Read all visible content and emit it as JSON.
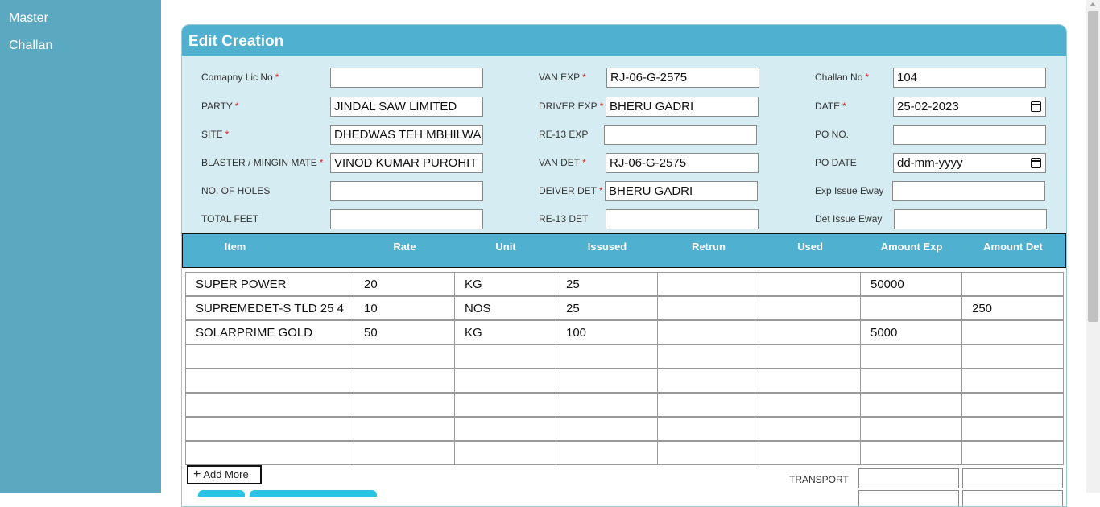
{
  "sidebar": {
    "items": [
      {
        "label": "Master"
      },
      {
        "label": "Challan"
      }
    ]
  },
  "card": {
    "title": "Edit Creation"
  },
  "form": {
    "col1": [
      {
        "label": "Comapny Lic No",
        "required": true,
        "value": ""
      },
      {
        "label": "PARTY",
        "required": true,
        "value": "JINDAL SAW LIMITED"
      },
      {
        "label": "SITE",
        "required": true,
        "value": "DHEDWAS TEH MBHILWA"
      },
      {
        "label": "BLASTER / MINGIN MATE",
        "required": true,
        "value": "VINOD KUMAR PUROHIT"
      },
      {
        "label": "NO. OF HOLES",
        "required": false,
        "value": ""
      },
      {
        "label": "TOTAL FEET",
        "required": false,
        "value": ""
      }
    ],
    "col2": [
      {
        "label": "VAN EXP",
        "required": true,
        "value": "RJ-06-G-2575"
      },
      {
        "label": "DRIVER EXP",
        "required": true,
        "value": "BHERU GADRI"
      },
      {
        "label": "RE-13 EXP",
        "required": false,
        "value": ""
      },
      {
        "label": "VAN DET",
        "required": true,
        "value": "RJ-06-G-2575"
      },
      {
        "label": "DEIVER DET",
        "required": true,
        "value": "BHERU GADRI"
      },
      {
        "label": "RE-13 DET",
        "required": false,
        "value": ""
      }
    ],
    "col3": [
      {
        "label": "Challan No",
        "required": true,
        "value": "104"
      },
      {
        "label": "DATE",
        "required": true,
        "value": "25-02-2023",
        "date": true
      },
      {
        "label": "PO NO.",
        "required": false,
        "value": ""
      },
      {
        "label": "PO DATE",
        "required": false,
        "value": "dd-mm-yyyy",
        "date": true
      },
      {
        "label": "Exp Issue Eway",
        "required": false,
        "value": ""
      },
      {
        "label": "Det Issue Eway",
        "required": false,
        "value": ""
      }
    ],
    "required_mark": "*"
  },
  "table": {
    "headers": [
      "Item",
      "Rate",
      "Unit",
      "Issused",
      "Retrun",
      "Used",
      "Amount Exp",
      "Amount Det"
    ],
    "rows": [
      [
        "SUPER POWER",
        "20",
        "KG",
        "25",
        "",
        "",
        "50000",
        ""
      ],
      [
        "SUPREMEDET-S TLD  25  4",
        "10",
        "NOS",
        "25",
        "",
        "",
        "",
        "250"
      ],
      [
        "SOLARPRIME GOLD",
        "50",
        "KG",
        "100",
        "",
        "",
        "5000",
        ""
      ],
      [
        "",
        "",
        "",
        "",
        "",
        "",
        "",
        ""
      ],
      [
        "",
        "",
        "",
        "",
        "",
        "",
        "",
        ""
      ],
      [
        "",
        "",
        "",
        "",
        "",
        "",
        "",
        ""
      ],
      [
        "",
        "",
        "",
        "",
        "",
        "",
        "",
        ""
      ],
      [
        "",
        "",
        "",
        "",
        "",
        "",
        "",
        ""
      ]
    ]
  },
  "footer": {
    "add_more_label": "Add More",
    "transport_label": "TRANSPORT"
  },
  "colors": {
    "sidebar": "#5ba8c1",
    "header": "#4fb0d0",
    "form_bg": "#d6ecf3",
    "required": "#e02020"
  }
}
